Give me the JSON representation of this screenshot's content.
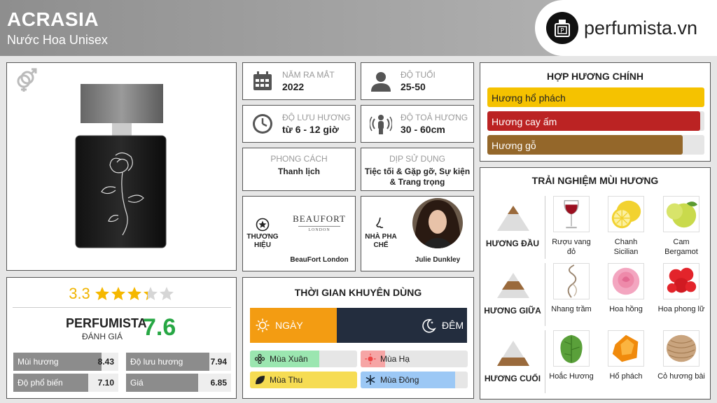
{
  "header": {
    "title": "ACRASIA",
    "subtitle": "Nước Hoa Unisex",
    "logo_text": "perfumista.vn"
  },
  "rating": {
    "value": "3.3",
    "stars": 3.3,
    "perfumista_label": "PERFUMISTA",
    "perfumista_sub": "ĐÁNH GIÁ",
    "perfumista_score": "7.6",
    "metrics": [
      {
        "name": "Mùi hương",
        "value": "8.43",
        "level": 0.843
      },
      {
        "name": "Độ lưu hương",
        "value": "7.94",
        "level": 0.794
      },
      {
        "name": "Độ phổ biến",
        "value": "7.10",
        "level": 0.71
      },
      {
        "name": "Giá",
        "value": "6.85",
        "level": 0.685
      }
    ]
  },
  "info": {
    "year": {
      "label": "NĂM RA MẮT",
      "value": "2022"
    },
    "age": {
      "label": "ĐỘ TUỔI",
      "value": "25-50"
    },
    "longevity": {
      "label": "ĐỘ LƯU HƯƠNG",
      "value": "từ 6 - 12 giờ"
    },
    "sillage": {
      "label": "ĐỘ TOẢ HƯƠNG",
      "value": "30 - 60cm"
    },
    "style": {
      "label": "PHONG CÁCH",
      "value": "Thanh lịch"
    },
    "occasion": {
      "label": "DỊP SỬ DỤNG",
      "value": "Tiệc tối & Gặp gỡ, Sự kiện & Trang trọng"
    },
    "brand": {
      "label": "THƯƠNG HIỆU",
      "value": "BeauFort London",
      "logo_text": "BEAUFORT",
      "logo_sub": "LONDON"
    },
    "perfumer": {
      "label": "NHÀ PHA CHẾ",
      "value": "Julie Dunkley"
    }
  },
  "time": {
    "title": "THỜI GIAN KHUYÊN DÙNG",
    "day": "NGÀY",
    "night": "ĐÊM",
    "seasons": [
      {
        "name": "Mùa Xuân",
        "level": 0.65,
        "color": "#9be6b0"
      },
      {
        "name": "Mùa Hạ",
        "level": 0.23,
        "color": "#f6a5a5"
      },
      {
        "name": "Mùa Thu",
        "level": 1.0,
        "color": "#f6dc53"
      },
      {
        "name": "Mùa Đông",
        "level": 0.88,
        "color": "#9cc8f5"
      }
    ]
  },
  "accords": {
    "title": "HỢP HƯƠNG CHÍNH",
    "items": [
      {
        "name": "Hương hổ phách",
        "level": 1.0,
        "color": "#f5c200",
        "text_color": "#222222"
      },
      {
        "name": "Hương cay ấm",
        "level": 0.98,
        "color": "#bb2323",
        "text_color": "#ffffff"
      },
      {
        "name": "Hương gỗ",
        "level": 0.9,
        "color": "#94672a",
        "text_color": "#ffffff"
      }
    ]
  },
  "notes": {
    "title": "TRẢI NGHIỆM MÙI HƯƠNG",
    "tiers": [
      {
        "label": "HƯƠNG ĐẦU",
        "items": [
          "Rượu vang đỏ",
          "Chanh Sicilian",
          "Cam Bergamot"
        ]
      },
      {
        "label": "HƯƠNG GIỮA",
        "items": [
          "Nhang trầm",
          "Hoa hồng",
          "Hoa phong lữ"
        ]
      },
      {
        "label": "HƯƠNG CUỐI",
        "items": [
          "Hoắc Hương",
          "Hổ phách",
          "Cỏ hương bài"
        ]
      }
    ]
  }
}
